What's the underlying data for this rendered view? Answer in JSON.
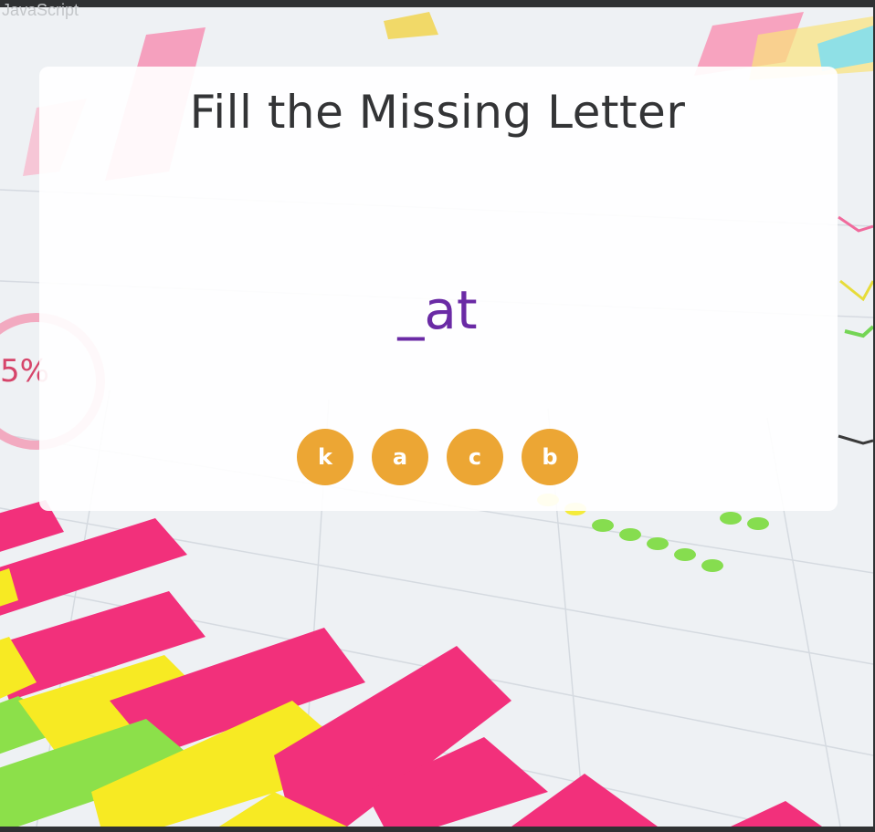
{
  "app": {
    "tab_title": "JavaScript"
  },
  "game": {
    "title": "Fill the Missing Letter",
    "word": "_at",
    "options": [
      "k",
      "a",
      "c",
      "b"
    ]
  },
  "colors": {
    "title": "#333436",
    "word": "#6a2aa5",
    "option_button": "#eca634",
    "option_text": "#ffffff",
    "card": "#ffffff"
  }
}
